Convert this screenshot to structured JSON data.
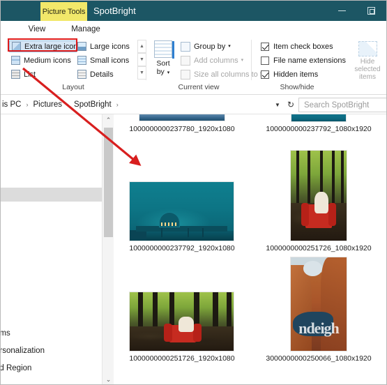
{
  "window": {
    "contextual_tab": "Picture Tools",
    "title": "SpotBright",
    "minimize_icon": "minimize-icon",
    "maximize_icon": "maximize-restore-icon",
    "accent_color": "#1c5664",
    "contextual_tab_color": "#f2e86a"
  },
  "ribbon": {
    "tabs": [
      {
        "label": "View",
        "selected": true
      },
      {
        "label": "Manage",
        "selected": false
      }
    ],
    "groups": [
      {
        "label": "Layout"
      },
      {
        "label": "Current view"
      },
      {
        "label": "Show/hide"
      }
    ],
    "layout_group": {
      "label": "Layout",
      "highlight_color": "#e01b1b",
      "view_modes": [
        {
          "label": "Extra large icons",
          "icon": "extra-large-icons-icon",
          "selected": true,
          "highlighted": true
        },
        {
          "label": "Large icons",
          "icon": "large-icons-icon",
          "selected": false,
          "highlighted": false
        },
        {
          "label": "Medium icons",
          "icon": "medium-icons-icon",
          "selected": false,
          "highlighted": false
        },
        {
          "label": "Small icons",
          "icon": "small-icons-icon",
          "selected": false,
          "highlighted": false
        },
        {
          "label": "List",
          "icon": "list-view-icon",
          "selected": false,
          "highlighted": false
        },
        {
          "label": "Details",
          "icon": "details-view-icon",
          "selected": false,
          "highlighted": false
        }
      ],
      "spinner": {
        "up": "▲",
        "down": "▼",
        "more": "▼"
      }
    },
    "current_view_group": {
      "label": "Current view",
      "sort_by": {
        "label_line1": "Sort",
        "label_line2": "by",
        "icon": "sort-by-icon",
        "caret": "▾"
      },
      "items": [
        {
          "label": "Group by",
          "icon": "group-by-icon",
          "caret": "▾",
          "enabled": true
        },
        {
          "label": "Add columns",
          "icon": "add-columns-icon",
          "caret": "▾",
          "enabled": false
        },
        {
          "label": "Size all columns to fit",
          "icon": "size-columns-icon",
          "caret": "",
          "enabled": false
        }
      ]
    },
    "show_hide_group": {
      "label": "Show/hide",
      "checkboxes": [
        {
          "label": "Item check boxes",
          "checked": true
        },
        {
          "label": "File name extensions",
          "checked": false
        },
        {
          "label": "Hidden items",
          "checked": true
        }
      ],
      "hide_selected": {
        "line1": "Hide selected",
        "line2": "items",
        "icon": "hide-selected-items-icon",
        "enabled": false
      }
    }
  },
  "address_bar": {
    "breadcrumbs": [
      "is PC",
      "Pictures",
      "SpotBright"
    ],
    "separator": "›",
    "trailing_separator": "›",
    "dropdown_icon": "chevron-down-icon",
    "refresh_icon": "refresh-icon",
    "refresh_glyph": "↻"
  },
  "search": {
    "placeholder": "Search SpotBright",
    "value": ""
  },
  "nav_pane": {
    "items": [
      {
        "label": "ems"
      },
      {
        "label": "ersonalization"
      },
      {
        "label": "nd Region"
      }
    ],
    "scrollbar": {
      "up_glyph": "⌃",
      "down_glyph": "⌄"
    }
  },
  "content": {
    "files": [
      {
        "name": "1000000000237780_1920x1080",
        "art": "strip-blue",
        "clipped_top": true
      },
      {
        "name": "1000000000237792_1080x1920",
        "art": "strip-teal",
        "clipped_top": true
      },
      {
        "name": "1000000000237792_1920x1080",
        "art": "pier",
        "clipped_top": false
      },
      {
        "name": "1000000000251726_1080x1920",
        "art": "chair-portrait",
        "clipped_top": false
      },
      {
        "name": "1000000000251726_1920x1080",
        "art": "chair-landscape",
        "clipped_top": false
      },
      {
        "name": "3000000000250066_1080x1920",
        "art": "canyon",
        "watermark": "ndeigh",
        "clipped_top": false
      }
    ]
  },
  "annotation": {
    "arrow_color": "#d81f1f",
    "box_color": "#e01b1b",
    "target_label": "Extra large icons"
  }
}
